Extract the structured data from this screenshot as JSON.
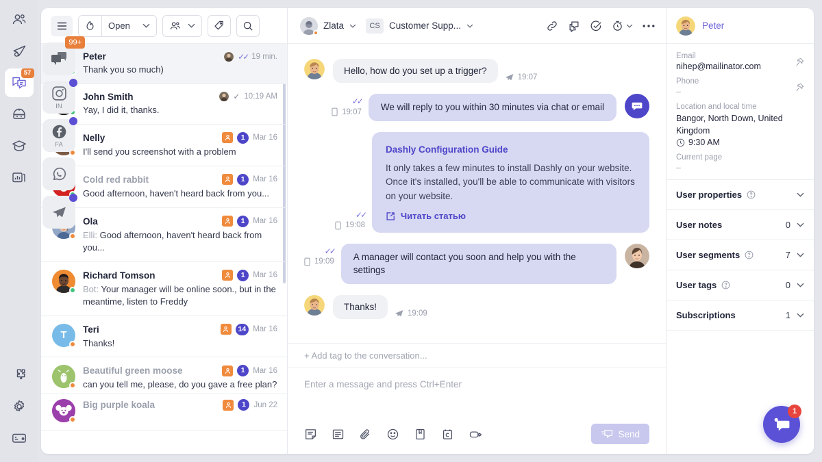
{
  "nav_rail": {
    "items": [
      {
        "name": "leads-icon",
        "badge": null
      },
      {
        "name": "campaigns-icon",
        "badge": null
      },
      {
        "name": "conversations-icon",
        "badge": "57",
        "active": true
      },
      {
        "name": "bot-icon",
        "badge": null
      },
      {
        "name": "knowledge-icon",
        "badge": null
      },
      {
        "name": "analytics-icon",
        "badge": null
      }
    ],
    "bottom_items": [
      {
        "name": "integrations-icon"
      },
      {
        "name": "settings-icon"
      },
      {
        "name": "billing-icon"
      }
    ]
  },
  "channels": [
    {
      "name": "chat-channel",
      "label": "",
      "badge": "99+",
      "dot": false
    },
    {
      "name": "instagram-channel",
      "label": "IN",
      "badge": null,
      "dot": true
    },
    {
      "name": "facebook-channel",
      "label": "FA",
      "badge": null,
      "dot": true
    },
    {
      "name": "whatsapp-channel",
      "label": "",
      "badge": null,
      "dot": false
    },
    {
      "name": "telegram-channel",
      "label": "",
      "badge": null,
      "dot": true
    }
  ],
  "conv_toolbar": {
    "burger_label": "menu",
    "status_filter": "Open",
    "assignee_filter": "",
    "tag_button": "tag",
    "search_button": "search"
  },
  "conversations": [
    {
      "name": "Peter",
      "snippet": "Thank you so much)",
      "time": "19 min.",
      "presence": "online",
      "ticks": "double",
      "agent_avatar": true,
      "assigned": false,
      "count": null,
      "selected": true,
      "avatar_type": "photo-male-blond",
      "avatar_bg": "#f5d77a",
      "muted_name": false
    },
    {
      "name": "John Smith",
      "snippet": "Yay, I did it, thanks.",
      "time": "10:19 AM",
      "presence": "online",
      "ticks": "single",
      "agent_avatar": true,
      "assigned": false,
      "count": null,
      "selected": false,
      "avatar_type": "photo-male-dark",
      "avatar_bg": "#3a3a3a",
      "muted_name": false
    },
    {
      "name": "Nelly",
      "snippet": "I'll send you screenshot with a problem",
      "time": "Mar 16",
      "presence": "away",
      "ticks": null,
      "agent_avatar": false,
      "assigned": true,
      "count": "1",
      "selected": false,
      "avatar_type": "photo-female-brown",
      "avatar_bg": "#b08060",
      "muted_name": false
    },
    {
      "name": "Cold red rabbit",
      "snippet": "Good afternoon, haven't heard back from you...",
      "time": "Mar 16",
      "presence": "online",
      "ticks": null,
      "agent_avatar": false,
      "assigned": true,
      "count": "1",
      "selected": false,
      "avatar_type": "animal-rabbit",
      "avatar_bg": "#d32323",
      "muted_name": true
    },
    {
      "name": "Ola",
      "snippet": "Good afternoon, haven't heard back from you...",
      "who": "Elli:",
      "time": "Mar 16",
      "presence": "away",
      "ticks": null,
      "agent_avatar": false,
      "assigned": true,
      "count": "1",
      "selected": false,
      "avatar_type": "photo-female-long",
      "avatar_bg": "#93a8c6",
      "muted_name": false
    },
    {
      "name": "Richard Tomson",
      "snippet": "Your manager will be online soon., but in the meantime, listen to Freddy",
      "who": "Bot:",
      "time": "Mar 16",
      "presence": "online",
      "ticks": null,
      "agent_avatar": false,
      "assigned": true,
      "count": "1",
      "selected": false,
      "avatar_type": "photo-male-orange",
      "avatar_bg": "#ef8b32",
      "muted_name": false
    },
    {
      "name": "Teri",
      "snippet": "Thanks!",
      "time": "Mar 16",
      "presence": "away",
      "ticks": null,
      "agent_avatar": false,
      "assigned": true,
      "count": "14",
      "selected": false,
      "avatar_type": "letter",
      "letter": "T",
      "avatar_bg": "#78bbe8",
      "muted_name": false
    },
    {
      "name": "Beautiful green moose",
      "snippet": "can you tell me, please, do you gave a free plan?",
      "time": "Mar 16",
      "presence": "away",
      "ticks": null,
      "agent_avatar": false,
      "assigned": true,
      "count": "1",
      "selected": false,
      "avatar_type": "animal-moose",
      "avatar_bg": "#9dc46c",
      "muted_name": true
    },
    {
      "name": "Big purple koala",
      "snippet": "",
      "time": "Jun 22",
      "presence": "away",
      "ticks": null,
      "agent_avatar": false,
      "assigned": true,
      "count": "1",
      "selected": false,
      "avatar_type": "animal-koala",
      "avatar_bg": "#9b3fab",
      "muted_name": true
    }
  ],
  "chat_header": {
    "user_name": "Zlata",
    "team_initials": "CS",
    "team_name": "Customer Supp...",
    "actions": [
      "link-icon",
      "comment-icon",
      "check-circle-icon",
      "snooze-icon",
      "more-icon"
    ]
  },
  "messages": [
    {
      "id": "m1",
      "dir": "in",
      "text": "Hello, how do you set up a trigger?",
      "time": "19:07",
      "channel_icon": "telegram-send-icon",
      "avatar": "photo-male-blond"
    },
    {
      "id": "m2",
      "dir": "out",
      "text": "We will reply to you within 30 minutes via chat or email",
      "time": "19:07",
      "channel_icon": "mobile-icon",
      "ticks": "double",
      "avatar": "bot"
    },
    {
      "id": "m3",
      "dir": "out",
      "type": "card",
      "card_title": "Dashly Configuration Guide",
      "card_text": "It only takes a few minutes to install Dashly on your website. Once it's installed, you'll be able to communicate with visitors on your website.",
      "card_link": "Читать статью",
      "time": "19:08",
      "channel_icon": "mobile-icon",
      "ticks": "double"
    },
    {
      "id": "m4",
      "dir": "out",
      "text": "A manager will contact you soon and help you with the settings",
      "time": "19:09",
      "channel_icon": "mobile-icon",
      "ticks": "double",
      "avatar": "photo-female-agent"
    },
    {
      "id": "m5",
      "dir": "in",
      "text": "Thanks!",
      "time": "19:09",
      "channel_icon": "telegram-send-icon",
      "avatar": "photo-male-blond"
    }
  ],
  "composer": {
    "tag_placeholder": "+ Add tag to the conversation...",
    "message_placeholder": "Enter a message and press Ctrl+Enter",
    "tools": [
      "note-icon",
      "saved-reply-icon",
      "attach-icon",
      "emoji-icon",
      "article-icon",
      "snippet-icon",
      "video-icon"
    ],
    "send_label": "Send"
  },
  "props": {
    "user_name": "Peter",
    "fields": [
      {
        "label": "Email",
        "value": "nihep@mailinator.com",
        "pinnable": true
      },
      {
        "label": "Phone",
        "value": "–",
        "pinnable": true
      }
    ],
    "location_label": "Location and local time",
    "location_value": "Bangor, North Down, United Kingdom",
    "local_time": "9:30 AM",
    "current_page_label": "Current page",
    "current_page_value": "–",
    "accordions": [
      {
        "title": "User properties",
        "help": true,
        "count": ""
      },
      {
        "title": "User notes",
        "help": false,
        "count": "0"
      },
      {
        "title": "User segments",
        "help": true,
        "count": "7"
      },
      {
        "title": "User tags",
        "help": true,
        "count": "0"
      },
      {
        "title": "Subscriptions",
        "help": false,
        "count": "1"
      }
    ]
  },
  "fab": {
    "badge": "1"
  },
  "colors": {
    "accent": "#4e46c9",
    "accent_light": "#d7d8f2",
    "orange": "#e8803c",
    "green": "#3fc47c",
    "red": "#e8453c"
  }
}
